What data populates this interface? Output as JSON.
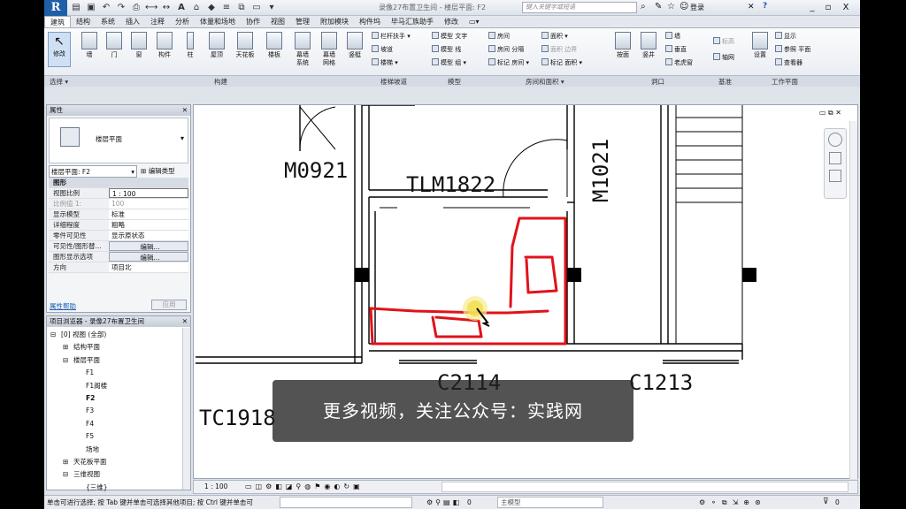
{
  "app": {
    "logo": "R",
    "title": "录像27布置卫生间 - 楼层平面: F2",
    "search_placeholder": "键入关键字或短语",
    "login": "登录",
    "help": "?",
    "win_min": "_",
    "win_max": "▫",
    "win_close": "X"
  },
  "menu_tabs": [
    "建筑",
    "结构",
    "系统",
    "插入",
    "注释",
    "分析",
    "体量和场地",
    "协作",
    "视图",
    "管理",
    "附加模块",
    "构件坞",
    "毕马汇族助手",
    "修改",
    "▭▾"
  ],
  "ribbon": {
    "modify": "修改",
    "build_big": [
      "墙",
      "门",
      "窗",
      "构件",
      "柱",
      "屋顶",
      "天花板",
      "楼板",
      "幕墙\n系统",
      "幕墙\n网格",
      "竖梃"
    ],
    "stair_items": [
      "栏杆扶手",
      "坡道",
      "楼梯"
    ],
    "model_items": [
      "模型 文字",
      "模型 线",
      "模型 组"
    ],
    "room_items": [
      "房间",
      "房间 分隔",
      "标记 房间",
      "面积",
      "面积 边界",
      "标记 面积"
    ],
    "opening_items": [
      "按面",
      "竖井",
      "墙",
      "垂直",
      "老虎窗"
    ],
    "datum_items": [
      "标高",
      "轴网"
    ],
    "workplane_items": [
      "设置",
      "显示",
      "参照 平面",
      "查看器"
    ],
    "panels": [
      "选择 ▾",
      "构建",
      "楼梯坡道",
      "模型",
      "房间和面积 ▾",
      "洞口",
      "基准",
      "工作平面"
    ]
  },
  "properties": {
    "title": "属性",
    "type_name": "楼层平面",
    "view_selector": "楼层平面: F2",
    "edit_type": "编辑类型",
    "section": "图形",
    "rows": [
      {
        "k": "视图比例",
        "v": "1 : 100"
      },
      {
        "k": "比例值 1:",
        "v": "100"
      },
      {
        "k": "显示模型",
        "v": "标准"
      },
      {
        "k": "详细程度",
        "v": "粗略"
      },
      {
        "k": "零件可见性",
        "v": "显示原状态"
      },
      {
        "k": "可见性/图形替...",
        "v": "编辑..."
      },
      {
        "k": "图形显示选项",
        "v": "编辑..."
      },
      {
        "k": "方向",
        "v": "项目北"
      }
    ],
    "help_link": "属性帮助",
    "apply": "应用"
  },
  "browser": {
    "title": "项目浏览器 - 录像27布置卫生间",
    "nodes": [
      {
        "label": "[0] 视图 (全部)",
        "level": 0,
        "expander": "⊟"
      },
      {
        "label": "结构平面",
        "level": 1,
        "expander": "⊞"
      },
      {
        "label": "楼层平面",
        "level": 1,
        "expander": "⊟"
      },
      {
        "label": "F1",
        "level": 2,
        "expander": ""
      },
      {
        "label": "F1阁楼",
        "level": 2,
        "expander": ""
      },
      {
        "label": "F2",
        "level": 2,
        "expander": "",
        "bold": true
      },
      {
        "label": "F3",
        "level": 2,
        "expander": ""
      },
      {
        "label": "F4",
        "level": 2,
        "expander": ""
      },
      {
        "label": "F5",
        "level": 2,
        "expander": ""
      },
      {
        "label": "场地",
        "level": 2,
        "expander": ""
      },
      {
        "label": "天花板平面",
        "level": 1,
        "expander": "⊞"
      },
      {
        "label": "三维视图",
        "level": 1,
        "expander": "⊟"
      },
      {
        "label": "{三维}",
        "level": 2,
        "expander": ""
      }
    ]
  },
  "drawing": {
    "labels": [
      "M0921",
      "TLM1822",
      "M1021",
      "C2114",
      "C1213",
      "TC1918"
    ],
    "sketch_color": "#e0121a",
    "cursor_ring_color": "#f3e06a"
  },
  "view_control": {
    "scale": "1 : 100"
  },
  "status": {
    "hint": "单击可进行选择; 按 Tab 键并单击可选择其他项目; 按 Ctrl 键并单击可",
    "workset": "主模型",
    "filter": "0"
  },
  "overlay": {
    "text": "更多视频，关注公众号：实践网"
  }
}
